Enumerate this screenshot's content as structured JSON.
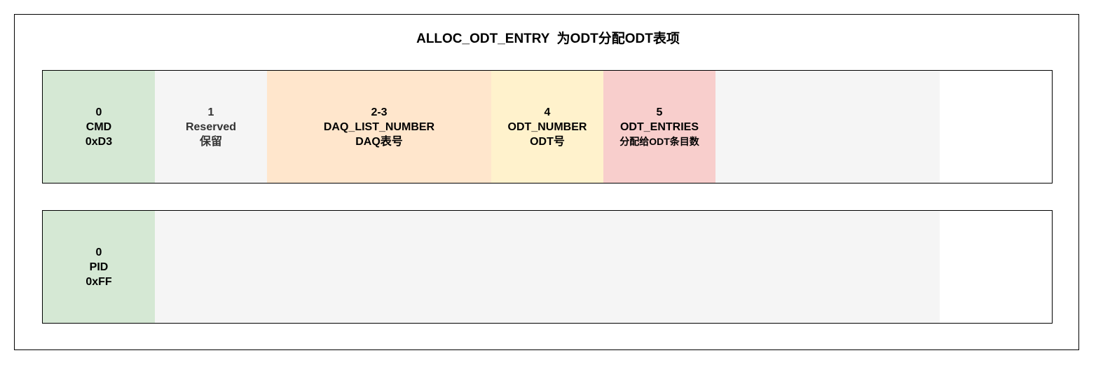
{
  "title": "ALLOC_ODT_ENTRY  为ODT分配ODT表项",
  "command_packet": [
    {
      "lines": [
        "0",
        "CMD",
        "0xD3"
      ],
      "color": "#d5e8d4"
    },
    {
      "lines": [
        "1",
        "Reserved",
        "保留"
      ],
      "color": "#f5f5f5"
    },
    {
      "lines": [
        "2-3",
        "DAQ_LIST_NUMBER",
        "DAQ表号"
      ],
      "color": "#ffe6cc"
    },
    {
      "lines": [
        "4",
        "ODT_NUMBER",
        "ODT号"
      ],
      "color": "#fff2cc"
    },
    {
      "lines": [
        "5",
        "ODT_ENTRIES",
        "分配给ODT条目数"
      ],
      "color": "#f8cecc"
    },
    {
      "lines": [],
      "color": "#f5f5f5"
    }
  ],
  "response_packet": [
    {
      "lines": [
        "0",
        "PID",
        "0xFF"
      ],
      "color": "#d5e8d4"
    },
    {
      "lines": [],
      "color": "#f5f5f5"
    }
  ]
}
